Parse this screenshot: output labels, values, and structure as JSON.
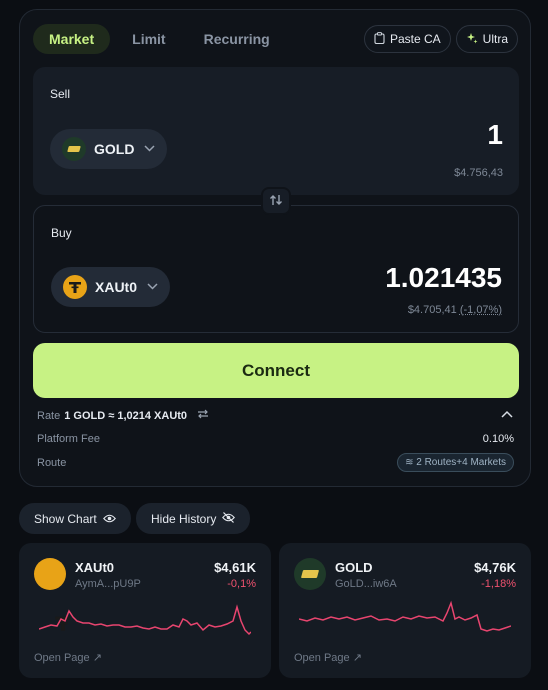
{
  "tabs": [
    {
      "label": "Market",
      "active": true
    },
    {
      "label": "Limit",
      "active": false
    },
    {
      "label": "Recurring",
      "active": false
    }
  ],
  "header_buttons": {
    "paste_ca": "Paste CA",
    "ultra": "Ultra"
  },
  "sell": {
    "label": "Sell",
    "token": "GOLD",
    "amount": "1",
    "usd": "$4.756,43"
  },
  "buy": {
    "label": "Buy",
    "token": "XAUt0",
    "amount": "1.021435",
    "usd": "$4.705,41",
    "pct": "(-1,07%)"
  },
  "connect_label": "Connect",
  "rate": {
    "label": "Rate",
    "value": "1 GOLD ≈ 1,0214 XAUt0"
  },
  "platform_fee": {
    "label": "Platform Fee",
    "value": "0.10%"
  },
  "route": {
    "label": "Route",
    "value": "2 Routes+4 Markets"
  },
  "show_chart": "Show Chart",
  "hide_history": "Hide History",
  "token_cards": [
    {
      "symbol": "XAUt0",
      "address": "AymA...pU9P",
      "price": "$4,61K",
      "change": "-0,1%",
      "open": "Open Page ↗"
    },
    {
      "symbol": "GOLD",
      "address": "GoLD...iw6A",
      "price": "$4,76K",
      "change": "-1,18%",
      "open": "Open Page ↗"
    }
  ],
  "colors": {
    "accent": "#c7f284",
    "negative": "#f0526f",
    "sparkline": "#e8456f"
  },
  "icons": [
    "clipboard-icon",
    "sparkle-icon",
    "chevron-down-icon",
    "swap-arrows-icon",
    "exchange-icon",
    "chevron-up-icon",
    "route-icon",
    "eye-icon",
    "eye-off-icon",
    "external-link-icon"
  ]
}
